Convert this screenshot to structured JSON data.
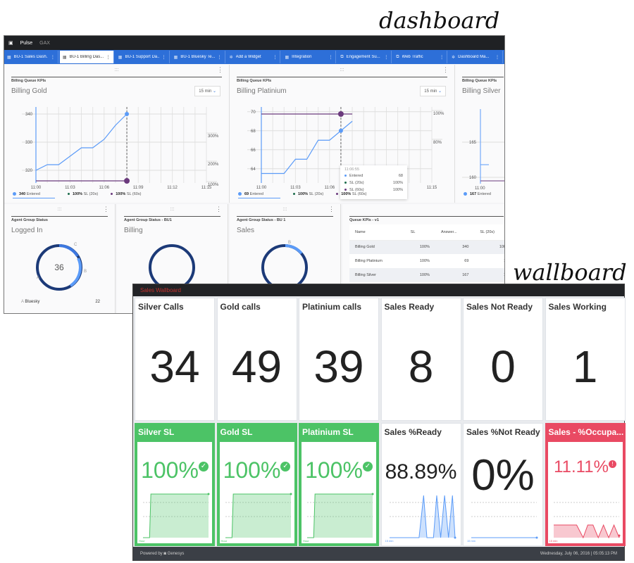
{
  "labels": {
    "dashboard": "dashboard",
    "wallboard": "wallboard"
  },
  "dashboard": {
    "app": "Pulse",
    "section": "GAX",
    "tabs": [
      {
        "label": "BU-1 Sales Dash...",
        "icon": "grid-icon"
      },
      {
        "label": "BU-1 Billing Das...",
        "icon": "grid-icon",
        "active": true
      },
      {
        "label": "BU-1 Support Da...",
        "icon": "grid-icon"
      },
      {
        "label": "BU-1 Bluesky Te...",
        "icon": "grid-icon"
      },
      {
        "label": "Add a Widget",
        "icon": "gear-icon"
      },
      {
        "label": "Integration",
        "icon": "grid-icon"
      },
      {
        "label": "Engagement Su...",
        "icon": "external-icon"
      },
      {
        "label": "Web Traffic",
        "icon": "external-icon"
      },
      {
        "label": "Dashboard Ma...",
        "icon": "gear-icon"
      }
    ],
    "kpi_widgets": [
      {
        "subtitle": "Billing Queue KPIs",
        "title": "Billing Gold",
        "interval": "15 min",
        "x_ticks": [
          "11:00",
          "11:03",
          "11:06",
          "11:09",
          "11:12",
          "11:15"
        ],
        "y_ticks": [
          "340",
          "330",
          "320"
        ],
        "y2_ticks": [
          "300%",
          "200%",
          "100%"
        ],
        "entered": [
          320,
          322,
          322,
          325,
          328,
          328,
          331,
          336,
          340
        ],
        "legend": {
          "entered_value": "340",
          "entered_label": "Entered",
          "sl20_value": "100%",
          "sl20_label": "SL (20s)",
          "sl60_value": "100%",
          "sl60_label": "SL (60s)"
        }
      },
      {
        "subtitle": "Billing Queue KPIs",
        "title": "Billing Platinium",
        "interval": "15 min",
        "x_ticks": [
          "11:00",
          "11:03",
          "11:06",
          "11:09",
          "11:12",
          "11:15"
        ],
        "y_ticks": [
          "70",
          "68",
          "66",
          "64"
        ],
        "y2_ticks": [
          "100%",
          "80%"
        ],
        "entered": [
          63.5,
          63.5,
          63.5,
          65,
          65,
          67,
          67,
          68,
          69
        ],
        "tooltip": {
          "time": "11:06:55",
          "rows": [
            {
              "label": "Entered",
              "value": "68"
            },
            {
              "label": "SL (20s)",
              "value": "100%"
            },
            {
              "label": "SL (60s)",
              "value": "100%"
            }
          ]
        },
        "legend": {
          "entered_value": "69",
          "entered_label": "Entered",
          "sl20_value": "100%",
          "sl20_label": "SL (20s)",
          "sl60_value": "100%",
          "sl60_label": "SL (60s)"
        }
      },
      {
        "subtitle": "Billing Queue KPIs",
        "title": "Billing Silver",
        "y_ticks": [
          "165",
          "160"
        ],
        "x_ticks": [
          "11:00"
        ],
        "legend": {
          "entered_value": "167",
          "entered_label": "Entered"
        }
      }
    ],
    "status_widgets": [
      {
        "subtitle": "Agent Group Status",
        "title": "Logged In",
        "center": "36",
        "segments": [
          "A",
          "B",
          "C"
        ],
        "list": [
          {
            "key": "A",
            "label": "Bluesky",
            "value": "22"
          }
        ]
      },
      {
        "subtitle": "Agent Group Status - BU1",
        "title": "Billing"
      },
      {
        "subtitle": "Agent Group Status - BU 1",
        "title": "Sales",
        "segments": [
          "B"
        ]
      }
    ],
    "queue_table": {
      "subtitle": "Queue KPIs - v1",
      "columns": [
        "Name",
        "SL",
        "Answer...",
        "SL (20s)"
      ],
      "rows": [
        [
          "Billing Gold",
          "100%",
          "340",
          "100"
        ],
        [
          "Billing Platinium",
          "100%",
          "69",
          "1"
        ],
        [
          "Billing Silver",
          "100%",
          "167",
          "1"
        ]
      ]
    },
    "colors": {
      "tabs": "#2d6fd8",
      "entered": "#5b9bf8",
      "sl20": "#1b6b4a",
      "sl60": "#6b3a7d"
    }
  },
  "wallboard": {
    "title": "Sales Wallboard",
    "tiles_top": [
      {
        "title": "Silver Calls",
        "value": "34"
      },
      {
        "title": "Gold calls",
        "value": "49"
      },
      {
        "title": "Platinium calls",
        "value": "39"
      },
      {
        "title": "Sales Ready",
        "value": "8"
      },
      {
        "title": "Sales Not Ready",
        "value": "0"
      },
      {
        "title": "Sales Working",
        "value": "1"
      }
    ],
    "tiles_bottom": [
      {
        "title": "Silver SL",
        "value": "100%",
        "status": "ok",
        "scale": "Hour"
      },
      {
        "title": "Gold SL",
        "value": "100%",
        "status": "ok",
        "scale": "Hour"
      },
      {
        "title": "Platinium SL",
        "value": "100%",
        "status": "ok",
        "scale": "Hour"
      },
      {
        "title": "Sales %Ready",
        "value": "88.89%",
        "status": "neutral",
        "scale": "15 min"
      },
      {
        "title": "Sales %Not Ready",
        "value": "0%",
        "status": "neutral",
        "scale": "15 min"
      },
      {
        "title": "Sales - %Occupa...",
        "value": "11.11%",
        "status": "alert",
        "scale": "15 min"
      }
    ],
    "footer": {
      "powered": "Powered by",
      "brand": "Genesys",
      "datetime": "Wednesday, July 06, 2016 | 05:05:13 PM"
    },
    "colors": {
      "ok": "#4cc366",
      "alert": "#e94a63",
      "neutral": "#5b9bf8"
    }
  }
}
